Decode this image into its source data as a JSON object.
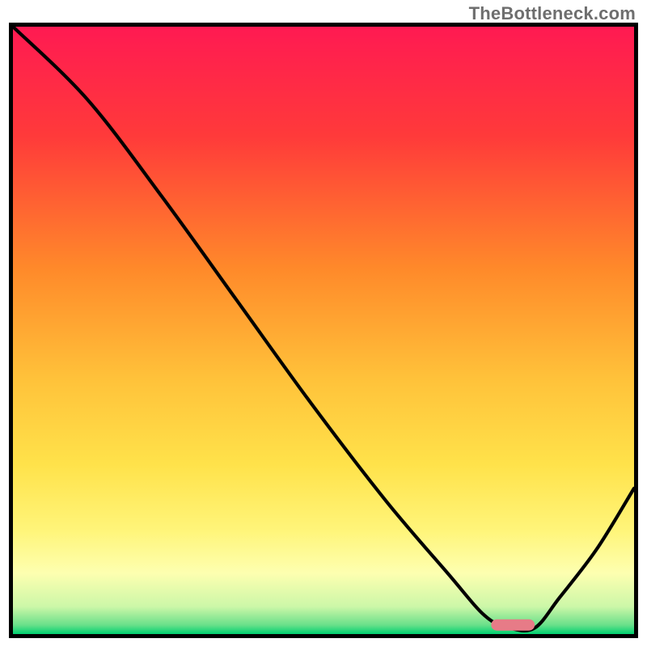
{
  "watermark": "TheBottleneck.com",
  "chart_data": {
    "type": "line",
    "title": "",
    "xlabel": "",
    "ylabel": "",
    "xlim": [
      0,
      100
    ],
    "ylim": [
      0,
      100
    ],
    "gradient_stops": [
      {
        "offset": 0,
        "color": "#ff1a52"
      },
      {
        "offset": 0.18,
        "color": "#ff3a3a"
      },
      {
        "offset": 0.4,
        "color": "#ff8a2a"
      },
      {
        "offset": 0.58,
        "color": "#ffc23a"
      },
      {
        "offset": 0.72,
        "color": "#ffe24a"
      },
      {
        "offset": 0.83,
        "color": "#fff57a"
      },
      {
        "offset": 0.9,
        "color": "#fdffb0"
      },
      {
        "offset": 0.955,
        "color": "#ccf7a8"
      },
      {
        "offset": 0.985,
        "color": "#6ae08a"
      },
      {
        "offset": 1.0,
        "color": "#00d070"
      }
    ],
    "series": [
      {
        "name": "bottleneck-curve",
        "x": [
          0,
          12,
          24,
          36,
          48,
          60,
          70,
          76,
          80,
          84,
          88,
          94,
          100
        ],
        "y": [
          100,
          88,
          72,
          55,
          38,
          22,
          10,
          3,
          1,
          1,
          6,
          14,
          24
        ]
      }
    ],
    "marker": {
      "name": "optimal-range",
      "x_start": 77,
      "x_end": 84,
      "y": 1.5,
      "color": "#e77b87"
    }
  }
}
